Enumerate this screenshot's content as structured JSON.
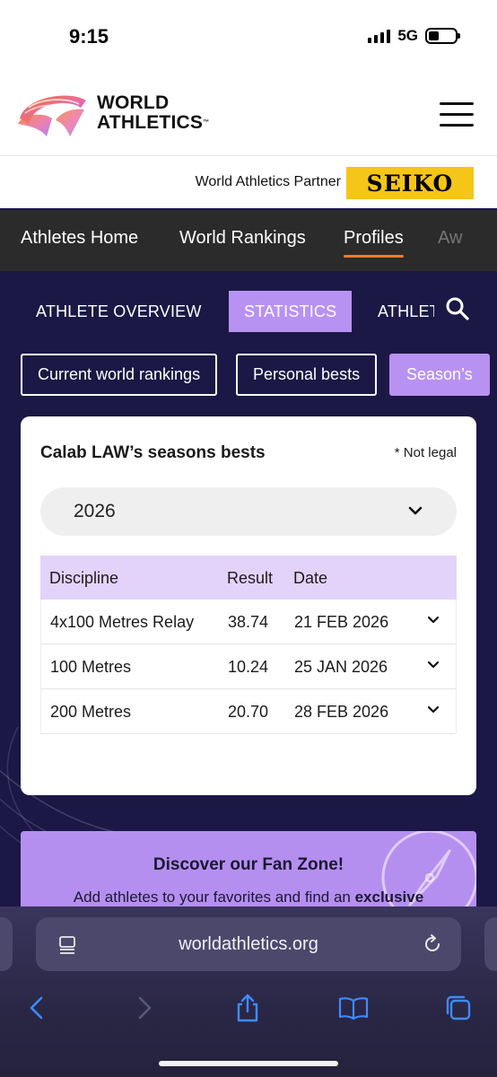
{
  "status": {
    "time": "9:15",
    "network": "5G"
  },
  "header": {
    "logo_line1": "WORLD",
    "logo_line2": "ATHLETICS",
    "logo_tm": "™"
  },
  "partner": {
    "label": "World Athletics Partner",
    "brand": "SEIKO"
  },
  "topnav": {
    "items": [
      "Athletes Home",
      "World Rankings",
      "Profiles",
      "Aw"
    ],
    "active": "Profiles"
  },
  "tabs": {
    "items": [
      "ATHLETE OVERVIEW",
      "STATISTICS",
      "ATHLET"
    ],
    "active": "STATISTICS"
  },
  "chips": {
    "items": [
      "Current world rankings",
      "Personal bests",
      "Season’s"
    ],
    "active": "Season’s"
  },
  "card": {
    "title": "Calab LAW’s seasons bests",
    "note": "* Not legal",
    "year": "2026",
    "columns": [
      "Discipline",
      "Result",
      "Date"
    ],
    "rows": [
      {
        "discipline": "4x100 Metres Relay",
        "result": "38.74",
        "date": "21 FEB 2026"
      },
      {
        "discipline": "100 Metres",
        "result": "10.24",
        "date": "25 JAN 2026"
      },
      {
        "discipline": "200 Metres",
        "result": "20.70",
        "date": "28 FEB 2026"
      }
    ]
  },
  "fanzone": {
    "title": "Discover our Fan Zone!",
    "text": "Add athletes to your favorites and find an",
    "text_bold": "exclusive"
  },
  "browser": {
    "url": "worldathletics.org"
  },
  "colors": {
    "accent": "#b892f2",
    "navy": "#1b1846",
    "orange": "#f07a2e",
    "seiko": "#f5c518"
  }
}
